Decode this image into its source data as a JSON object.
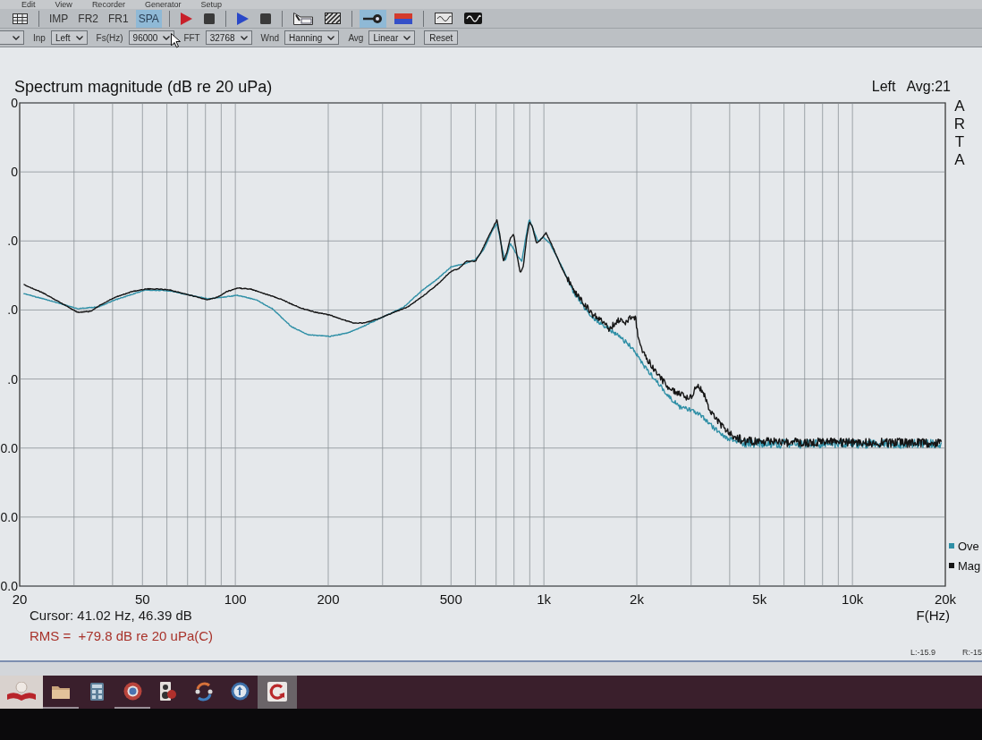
{
  "menu": {
    "items": [
      "Edit",
      "View",
      "Recorder",
      "Generator",
      "Setup"
    ]
  },
  "toolbar": {
    "groups": [
      {
        "items": [
          {
            "kind": "table",
            "selected": false
          }
        ]
      },
      {
        "items": [
          {
            "kind": "mode",
            "label": "IMP",
            "selected": false
          },
          {
            "kind": "mode",
            "label": "FR2",
            "selected": false
          },
          {
            "kind": "mode",
            "label": "FR1",
            "selected": false
          },
          {
            "kind": "mode",
            "label": "SPA",
            "selected": true
          }
        ]
      },
      {
        "items": [
          {
            "kind": "record",
            "selected": false
          },
          {
            "kind": "stop",
            "selected": false
          }
        ]
      },
      {
        "items": [
          {
            "kind": "play",
            "selected": false
          },
          {
            "kind": "stop",
            "selected": false
          }
        ]
      },
      {
        "items": [
          {
            "kind": "chart-box",
            "selected": false
          },
          {
            "kind": "hatched",
            "selected": false
          }
        ]
      },
      {
        "items": [
          {
            "kind": "line-dot",
            "selected": true
          },
          {
            "kind": "gradient-bar",
            "selected": false
          }
        ]
      },
      {
        "items": [
          {
            "kind": "sine-box",
            "selected": false
          },
          {
            "kind": "sine",
            "selected": false
          }
        ]
      }
    ]
  },
  "settings": [
    {
      "kind": "select"
    },
    {
      "kind": "select",
      "label": "Inp",
      "value": "Left"
    },
    {
      "kind": "select",
      "label": "Fs(Hz)",
      "value": "96000"
    },
    {
      "kind": "select",
      "label": "FFT",
      "value": "32768"
    },
    {
      "kind": "select",
      "label": "Wnd",
      "value": "Hanning"
    },
    {
      "kind": "select",
      "label": "Avg",
      "value": "Linear"
    },
    {
      "kind": "button",
      "label": "Reset"
    }
  ],
  "plot": {
    "title": "Spectrum magnitude (dB re 20 uPa)",
    "channel": "Left",
    "average": "Avg:21",
    "side_label": "ARTA",
    "y_tick_labels": [
      "0",
      "0",
      ".0",
      ".0",
      ".0",
      "0.0",
      "0.0",
      "0.0"
    ],
    "x_tick_labels": [
      "20",
      "50",
      "100",
      "200",
      "500",
      "1k",
      "2k",
      "5k",
      "10k",
      "20k"
    ],
    "x_axis_label": "F(Hz)",
    "legend": [
      {
        "label": "Ove",
        "color": "#2f8fa6"
      },
      {
        "label": "Mag",
        "color": "#151515"
      }
    ],
    "cursor": "Cursor: 41.02 Hz, 46.39 dB",
    "rms": "RMS =  +79.8 dB re 20 uPa(C)",
    "levels": [
      "L:-15.9",
      "R:-15"
    ]
  },
  "taskbar": {
    "items": [
      {
        "kind": "book",
        "open": false,
        "selected": false
      },
      {
        "kind": "folder",
        "open": true,
        "selected": false
      },
      {
        "kind": "calculator",
        "open": false,
        "selected": false
      },
      {
        "kind": "ring",
        "open": true,
        "selected": false
      },
      {
        "kind": "speaker",
        "open": false,
        "selected": false
      },
      {
        "kind": "sync",
        "open": false,
        "selected": false
      },
      {
        "kind": "disc",
        "open": false,
        "selected": false
      },
      {
        "kind": "circular-arrow",
        "open": false,
        "selected": true
      }
    ]
  }
}
